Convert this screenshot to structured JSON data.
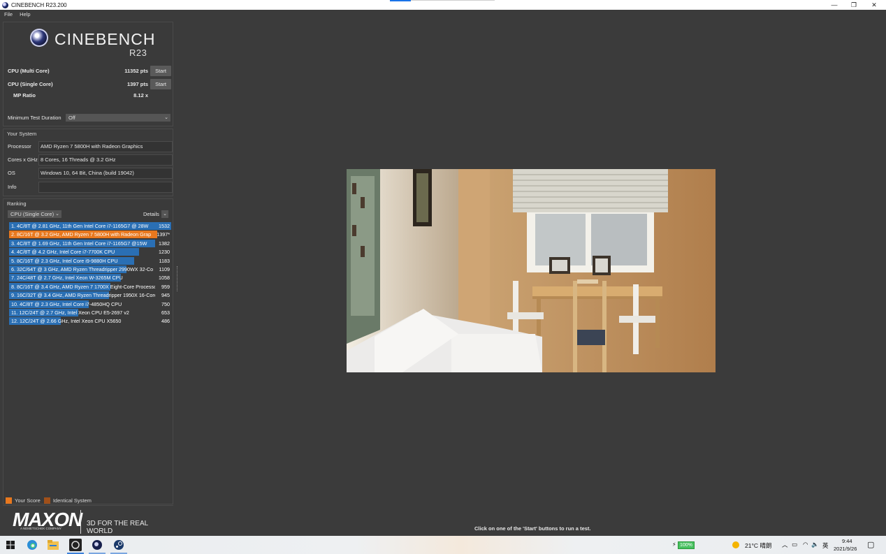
{
  "window": {
    "title": "CINEBENCH R23.200",
    "minimize_glyph": "—",
    "maximize_glyph": "❐",
    "close_glyph": "✕"
  },
  "menu": {
    "items": [
      "File",
      "Help"
    ]
  },
  "logo": {
    "name": "CINEBENCH",
    "version": "R23"
  },
  "scores": {
    "multi": {
      "label": "CPU (Multi Core)",
      "value": "11352 pts",
      "button": "Start"
    },
    "single": {
      "label": "CPU (Single Core)",
      "value": "1397 pts",
      "button": "Start"
    },
    "ratio": {
      "label": "MP Ratio",
      "value": "8.12 x"
    }
  },
  "min_duration": {
    "label": "Minimum Test Duration",
    "value": "Off"
  },
  "your_system": {
    "title": "Your System",
    "rows": [
      {
        "label": "Processor",
        "value": "AMD Ryzen 7 5800H with Radeon Graphics"
      },
      {
        "label": "Cores x GHz",
        "value": "8 Cores, 16 Threads @ 3.2 GHz"
      },
      {
        "label": "OS",
        "value": "Windows 10, 64 Bit, China (build 19042)"
      },
      {
        "label": "Info",
        "value": ""
      }
    ]
  },
  "ranking": {
    "title": "Ranking",
    "mode": "CPU (Single Core)",
    "details": "Details",
    "max_score": 1532,
    "items": [
      {
        "text": "1. 4C/8T @ 2.81 GHz, 11th Gen Intel Core i7-1165G7 @ 28W",
        "score": "1532",
        "value": 1532,
        "mine": false
      },
      {
        "text": "2. 8C/16T @ 3.2 GHz, AMD Ryzen 7 5800H with Radeon Grap",
        "score": "1397*",
        "value": 1397,
        "mine": true
      },
      {
        "text": "3. 4C/8T @ 1.69 GHz, 11th Gen Intel Core i7-1165G7 @15W",
        "score": "1382",
        "value": 1382,
        "mine": false
      },
      {
        "text": "4. 4C/8T @ 4.2 GHz, Intel Core i7-7700K CPU",
        "score": "1230",
        "value": 1230,
        "mine": false
      },
      {
        "text": "5. 8C/16T @ 2.3 GHz, Intel Core i9-9880H CPU",
        "score": "1183",
        "value": 1183,
        "mine": false
      },
      {
        "text": "6. 32C/64T @ 3 GHz, AMD Ryzen Threadripper 2990WX 32-Co",
        "score": "1109",
        "value": 1109,
        "mine": false
      },
      {
        "text": "7. 24C/48T @ 2.7 GHz, Intel Xeon W-3265M CPU",
        "score": "1058",
        "value": 1058,
        "mine": false
      },
      {
        "text": "8. 8C/16T @ 3.4 GHz, AMD Ryzen 7 1700X Eight-Core Processo",
        "score": "959",
        "value": 959,
        "mine": false
      },
      {
        "text": "9. 16C/32T @ 3.4 GHz, AMD Ryzen Threadripper 1950X 16-Core",
        "score": "945",
        "value": 945,
        "mine": false
      },
      {
        "text": "10. 4C/8T @ 2.3 GHz, Intel Core i7-4850HQ CPU",
        "score": "750",
        "value": 750,
        "mine": false
      },
      {
        "text": "11. 12C/24T @ 2.7 GHz, Intel Xeon CPU E5-2697 v2",
        "score": "653",
        "value": 653,
        "mine": false
      },
      {
        "text": "12. 12C/24T @ 2.66 GHz, Intel Xeon CPU X5650",
        "score": "486",
        "value": 486,
        "mine": false
      }
    ]
  },
  "legend": {
    "your_score": "Your Score",
    "identical": "Identical System"
  },
  "branding": {
    "company": "MAXON",
    "sub": "A NEMETSCHEK COMPANY",
    "tagline": "3D FOR THE REAL WORLD"
  },
  "status": "Click on one of the 'Start' buttons to run a test.",
  "taskbar": {
    "battery": "100%",
    "weather": "21°C  晴朗",
    "ime": "英",
    "time": "9:44",
    "date": "2021/9/26"
  },
  "colors": {
    "bar_blue": "#2a6fb4",
    "bar_orange": "#e8781e",
    "identical_swatch": "#a0501a",
    "background": "#3b3b3b"
  }
}
